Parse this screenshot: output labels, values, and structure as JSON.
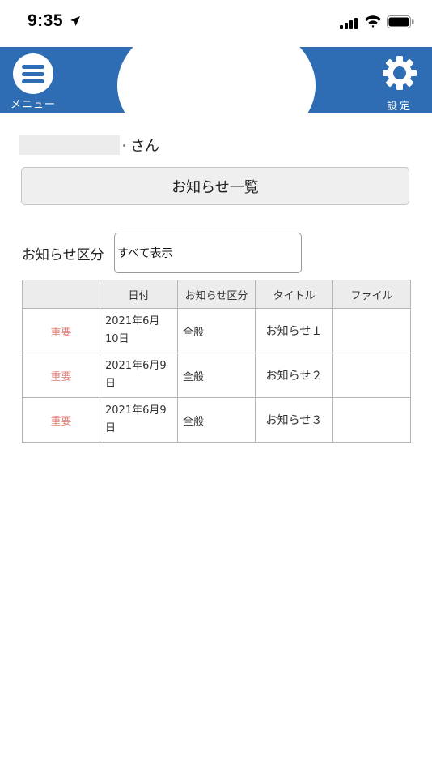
{
  "status_bar": {
    "time": "9:35"
  },
  "header": {
    "menu_label": "メニュー",
    "settings_label": "設定"
  },
  "greeting": {
    "suffix": "さん"
  },
  "notice_list_button": "お知らせ一覧",
  "filter": {
    "label": "お知らせ区分",
    "selected": "すべて表示"
  },
  "table": {
    "headers": [
      "",
      "日付",
      "お知らせ区分",
      "タイトル",
      "ファイル"
    ],
    "rows": [
      {
        "importance": "重要",
        "date": "2021年6月10日",
        "category": "全般",
        "title": "お知らせ１",
        "file": ""
      },
      {
        "importance": "重要",
        "date": "2021年6月9日",
        "category": "全般",
        "title": "お知らせ２",
        "file": ""
      },
      {
        "importance": "重要",
        "date": "2021年6月9日",
        "category": "全般",
        "title": "お知らせ３",
        "file": ""
      }
    ]
  },
  "colors": {
    "header_blue": "#2e6db4",
    "important_red": "#e0867c"
  }
}
